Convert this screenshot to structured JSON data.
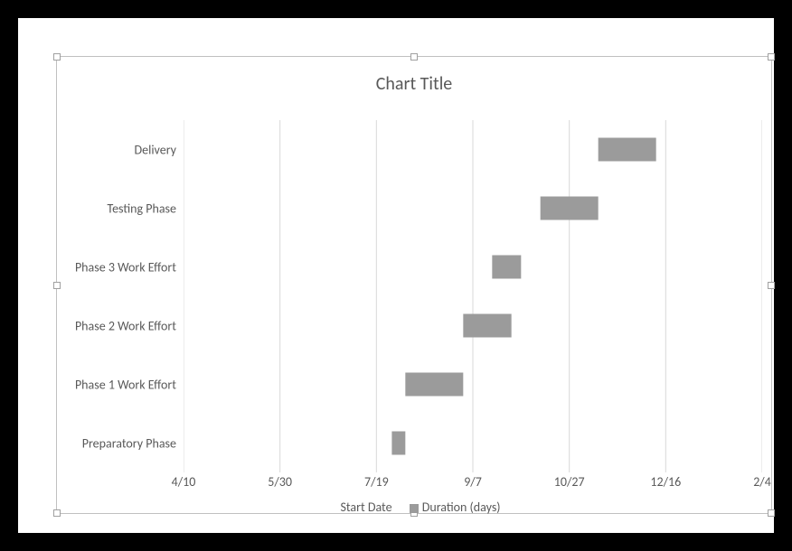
{
  "chart_data": {
    "type": "bar",
    "orientation": "horizontal_stacked_gantt",
    "title": "Chart Title",
    "xlabel": "",
    "ylabel": "",
    "x_axis_type": "date",
    "x_ticks": [
      "4/10",
      "5/30",
      "7/19",
      "9/7",
      "10/27",
      "12/16",
      "2/4"
    ],
    "x_tick_serials": [
      42104,
      42154,
      42204,
      42254,
      42304,
      42354,
      42404
    ],
    "xlim": [
      42104,
      42404
    ],
    "categories": [
      "Preparatory Phase",
      "Phase 1 Work Effort",
      "Phase 2 Work Effort",
      "Phase 3 Work Effort",
      "Testing Phase",
      "Delivery"
    ],
    "series": [
      {
        "name": "Start Date",
        "role": "offset_invisible",
        "values": [
          42212,
          42219,
          42249,
          42264,
          42289,
          42319
        ]
      },
      {
        "name": "Duration (days)",
        "role": "visible_bar",
        "values": [
          7,
          30,
          25,
          15,
          30,
          30
        ]
      }
    ],
    "legend_entries": [
      "Start Date",
      "Duration (days)"
    ],
    "legend_position": "bottom",
    "grid": {
      "x": true,
      "y": false
    }
  }
}
